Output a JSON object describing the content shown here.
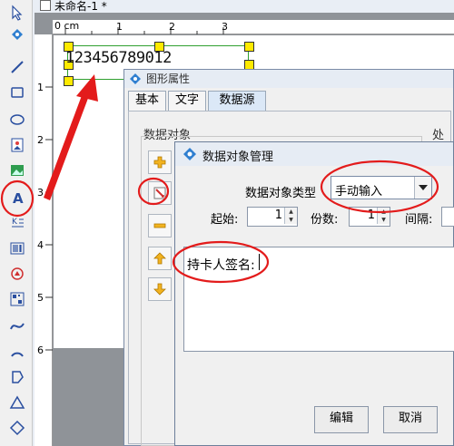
{
  "document": {
    "tab_title": "未命名-1 *"
  },
  "ruler": {
    "top_numbers": [
      "0",
      "1",
      "2",
      "3"
    ],
    "left_numbers": [
      "1",
      "2",
      "3",
      "4",
      "5",
      "6"
    ],
    "corner_text": "0 cm"
  },
  "label": {
    "sample_text": "123456789012"
  },
  "toolbar": {
    "tools": [
      "cursor-icon",
      "paint-icon",
      "line-icon",
      "rectangle-icon",
      "ellipse-icon",
      "image-icon",
      "picture-icon",
      "text-icon",
      "multiline-text-icon",
      "barcode-icon",
      "stamp-icon",
      "qrcode-icon",
      "curve-icon",
      "arc-icon",
      "polygon-icon",
      "triangle-icon",
      "diamond-icon"
    ]
  },
  "properties_dialog": {
    "title": "图形属性",
    "tabs": [
      "基本",
      "文字",
      "数据源"
    ],
    "active_tab": "数据源",
    "data_object_label": "数据对象",
    "process_label": "处理"
  },
  "manager_dialog": {
    "title": "数据对象管理",
    "type_label": "数据对象类型",
    "type_value": "手动输入",
    "start_label": "起始:",
    "start_value": "1",
    "copies_label": "份数:",
    "copies_value": "1",
    "interval_label": "间隔:",
    "text_value": "持卡人签名:",
    "edit_button": "编辑",
    "cancel_button": "取消"
  },
  "colors": {
    "annotation_red": "#e31b1b",
    "selection_green": "#30a030",
    "handle_yellow": "#ffea00"
  }
}
